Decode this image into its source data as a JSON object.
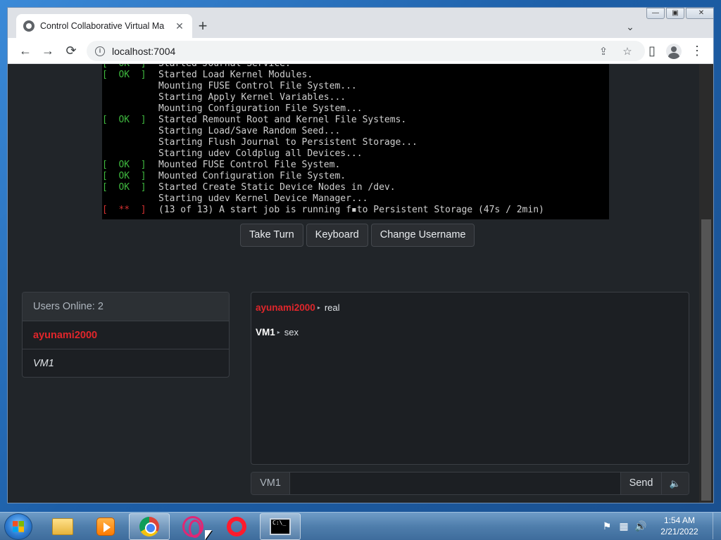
{
  "browser": {
    "tab_title": "Control Collaborative Virtual Ma",
    "tab_close": "✕",
    "new_tab": "+",
    "tab_search": "⌄",
    "win_minimize": "—",
    "win_maximize": "▣",
    "win_close": "✕",
    "back": "←",
    "forward": "→",
    "reload": "⟳",
    "info_glyph": "i",
    "url": "localhost:7004",
    "share_glyph": "⇪",
    "star_glyph": "☆",
    "sidepanel_glyph": "▯",
    "menu_glyph": "⋮"
  },
  "vm": {
    "console_lines": [
      {
        "status": "ok",
        "badge": "[  OK  ]",
        "text": "Started Journal Service."
      },
      {
        "status": "ok",
        "badge": "[  OK  ]",
        "text": "Started Load Kernel Modules."
      },
      {
        "status": "",
        "badge": "",
        "text": "Mounting FUSE Control File System..."
      },
      {
        "status": "",
        "badge": "",
        "text": "Starting Apply Kernel Variables..."
      },
      {
        "status": "",
        "badge": "",
        "text": "Mounting Configuration File System..."
      },
      {
        "status": "ok",
        "badge": "[  OK  ]",
        "text": "Started Remount Root and Kernel File Systems."
      },
      {
        "status": "",
        "badge": "",
        "text": "Starting Load/Save Random Seed..."
      },
      {
        "status": "",
        "badge": "",
        "text": "Starting Flush Journal to Persistent Storage..."
      },
      {
        "status": "",
        "badge": "",
        "text": "Starting udev Coldplug all Devices..."
      },
      {
        "status": "ok",
        "badge": "[  OK  ]",
        "text": "Mounted FUSE Control File System."
      },
      {
        "status": "ok",
        "badge": "[  OK  ]",
        "text": "Mounted Configuration File System."
      },
      {
        "status": "ok",
        "badge": "[  OK  ]",
        "text": "Started Create Static Device Nodes in /dev."
      },
      {
        "status": "",
        "badge": "",
        "text": "Starting udev Kernel Device Manager..."
      },
      {
        "status": "fail",
        "badge": "[  **  ]",
        "text": "(13 of 13) A start job is running f▪to Persistent Storage (47s / 2min)"
      }
    ],
    "take_turn": "Take Turn",
    "keyboard": "Keyboard",
    "change_username": "Change Username"
  },
  "users": {
    "header": "Users Online: 2",
    "list": [
      {
        "name": "ayunami2000",
        "style": "red"
      },
      {
        "name": "VM1",
        "style": "italic"
      }
    ]
  },
  "chat": {
    "messages": [
      {
        "user": "ayunami2000",
        "style": "red",
        "text": "real"
      },
      {
        "user": "VM1",
        "style": "white",
        "text": "sex"
      }
    ],
    "arrow_glyph": "▸",
    "input_prefix": "VM1",
    "input_value": "",
    "send": "Send",
    "sound_glyph": "🔈"
  },
  "taskbar": {
    "cmd_glyph": "C:\\_",
    "tray_flag": "⚑",
    "tray_network": "▦",
    "tray_volume": "🔊",
    "time": "1:54 AM",
    "date": "2/21/2022"
  }
}
